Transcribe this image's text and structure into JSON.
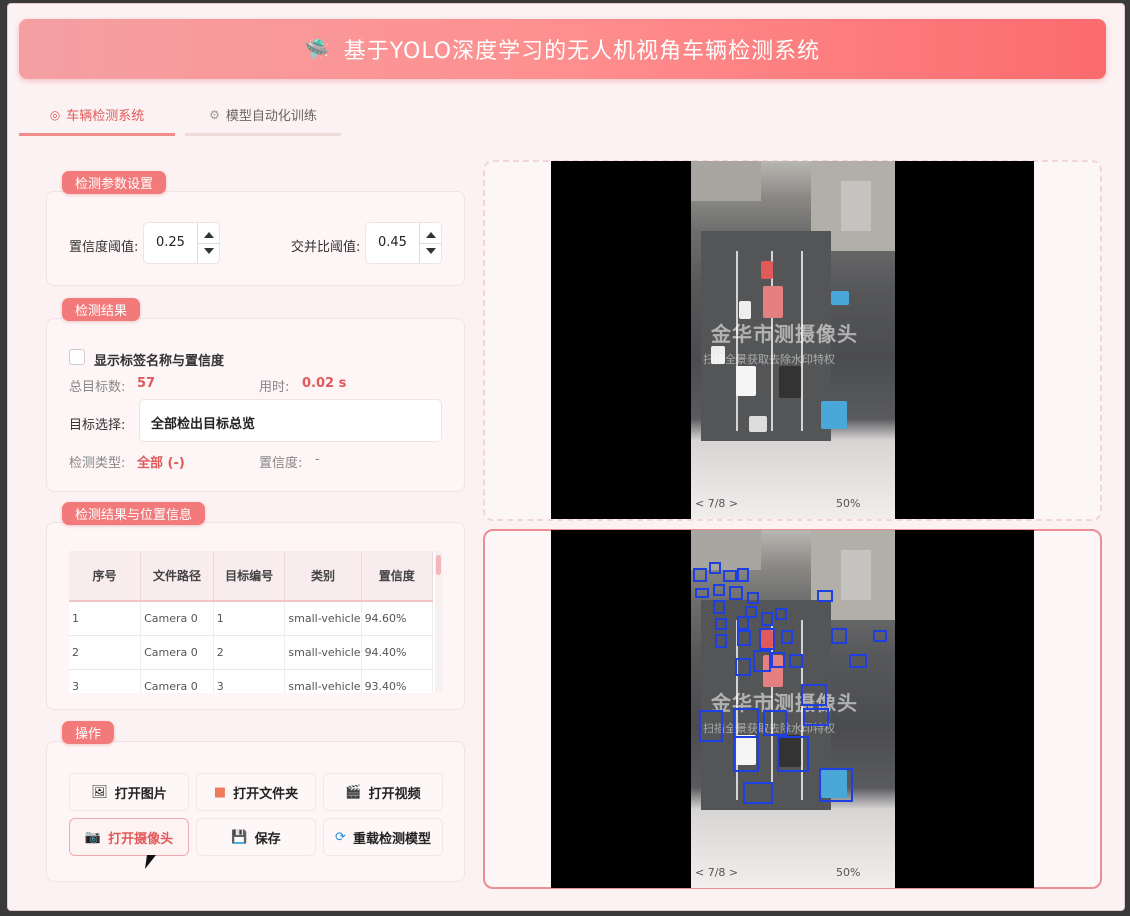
{
  "header": {
    "icon": "ufo-icon",
    "title": "基于YOLO深度学习的无人机视角车辆检测系统"
  },
  "tabs": [
    {
      "label": "车辆检测系统",
      "icon": "target-icon",
      "active": true
    },
    {
      "label": "模型自动化训练",
      "icon": "gear-icon",
      "active": false
    }
  ],
  "params": {
    "title": "检测参数设置",
    "conf_label": "置信度阈值:",
    "conf_value": "0.25",
    "iou_label": "交并比阈值:",
    "iou_value": "0.45"
  },
  "results": {
    "title": "检测结果",
    "show_labels": "显示标签名称与置信度",
    "total_label": "总目标数:",
    "total_value": "57",
    "time_label": "用时:",
    "time_value": "0.02 s",
    "target_label": "目标选择:",
    "target_value": "全部检出目标总览",
    "type_label": "检测类型:",
    "type_value": "全部 (-)",
    "conf_label": "置信度:",
    "conf_value": "-"
  },
  "table": {
    "title": "检测结果与位置信息",
    "columns": [
      "序号",
      "文件路径",
      "目标编号",
      "类别",
      "置信度"
    ],
    "rows": [
      [
        "1",
        "Camera 0",
        "1",
        "small-vehicle",
        "94.60%"
      ],
      [
        "2",
        "Camera 0",
        "2",
        "small-vehicle",
        "94.40%"
      ],
      [
        "3",
        "Camera 0",
        "3",
        "small-vehicle",
        "93.40%"
      ]
    ]
  },
  "actions": {
    "title": "操作",
    "buttons": [
      {
        "label": "打开图片",
        "icon": "image-icon"
      },
      {
        "label": "打开文件夹",
        "icon": "folder-icon"
      },
      {
        "label": "打开视频",
        "icon": "clapperboard-icon"
      },
      {
        "label": "打开摄像头",
        "icon": "camera-icon",
        "active": true
      },
      {
        "label": "保存",
        "icon": "floppy-icon"
      },
      {
        "label": "重载检测模型",
        "icon": "reload-icon"
      }
    ]
  },
  "video": {
    "watermark_main": "金华市测摄像头",
    "watermark_sub": "扫描全景获取去除水印特权",
    "bar_left": "< 7/8 >",
    "bar_zoom": "50%"
  },
  "colors": {
    "accent": "#f37a7a",
    "detection_box": "#1f3fe0",
    "header_start": "#f4a0a3",
    "header_end": "#fb6b6e"
  }
}
